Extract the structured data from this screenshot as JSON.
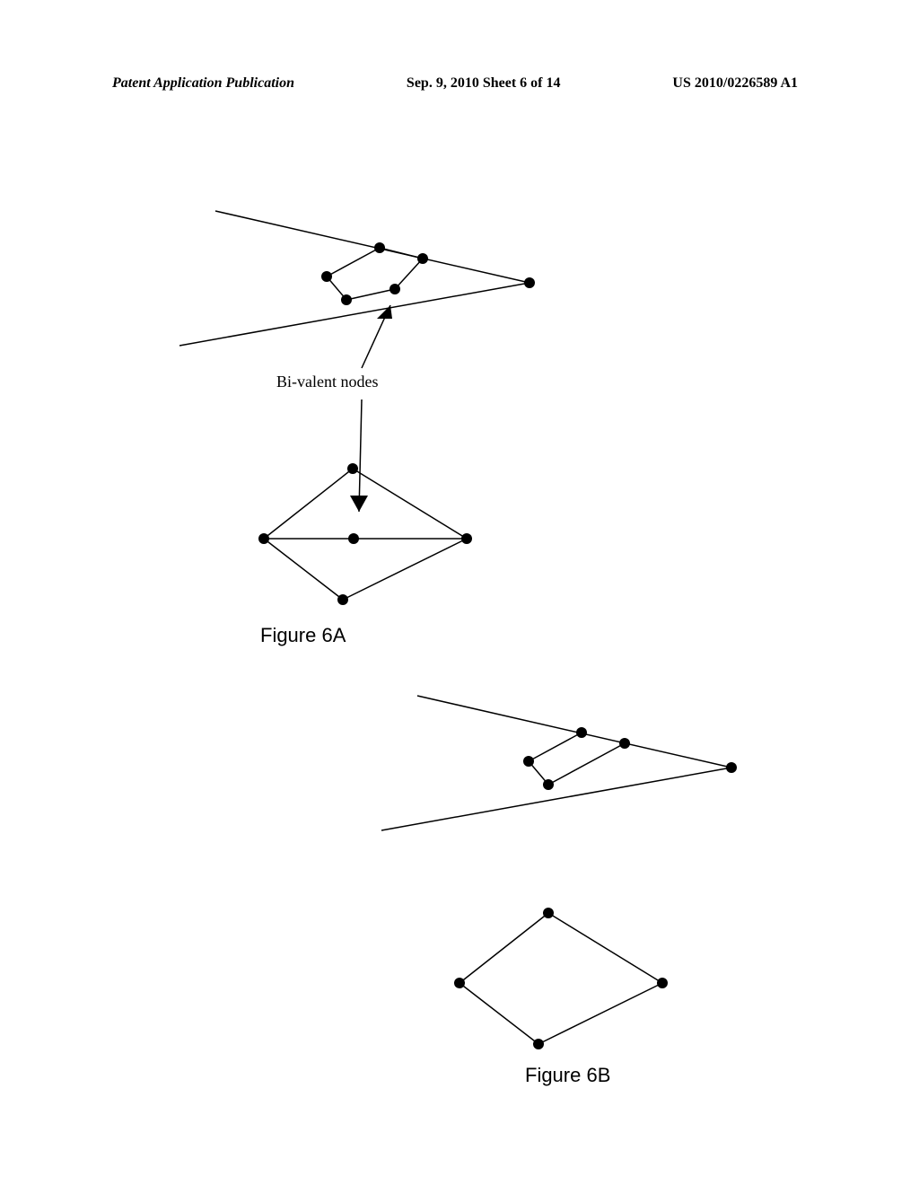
{
  "header": {
    "left": "Patent Application Publication",
    "center": "Sep. 9, 2010  Sheet 6 of 14",
    "right": "US 2010/0226589 A1"
  },
  "labels": {
    "bivalent": "Bi-valent nodes",
    "fig6a": "Figure 6A",
    "fig6b": "Figure 6B"
  },
  "chart_data": {
    "type": "diagram",
    "description": "Patent figure showing graph diagrams with bi-valent nodes before and after processing",
    "figure_6a": {
      "description": "Two graph diagrams with bi-valent nodes indicated by leader lines and arrows",
      "top_graph": {
        "nodes": [
          {
            "id": 1,
            "approx_pos": "upper-center"
          },
          {
            "id": 2,
            "approx_pos": "right"
          },
          {
            "id": 3,
            "approx_pos": "center",
            "bivalent": true
          },
          {
            "id": 4,
            "approx_pos": "center-lower",
            "bivalent": true
          },
          {
            "id": 5,
            "approx_pos": "lower-left"
          }
        ],
        "edges": [
          [
            1,
            2
          ],
          [
            2,
            3
          ],
          [
            3,
            4
          ],
          [
            4,
            1
          ],
          [
            2,
            5
          ]
        ]
      },
      "bottom_graph": {
        "nodes": [
          {
            "id": 1,
            "approx_pos": "top"
          },
          {
            "id": 2,
            "approx_pos": "center",
            "bivalent": true
          },
          {
            "id": 3,
            "approx_pos": "left"
          },
          {
            "id": 4,
            "approx_pos": "right"
          },
          {
            "id": 5,
            "approx_pos": "bottom"
          }
        ],
        "edges": [
          [
            1,
            3
          ],
          [
            1,
            4
          ],
          [
            3,
            2
          ],
          [
            2,
            4
          ],
          [
            3,
            5
          ],
          [
            5,
            4
          ]
        ]
      },
      "annotation": "Bi-valent nodes"
    },
    "figure_6b": {
      "description": "Same two graph diagrams after bi-valent node removal",
      "top_graph": {
        "nodes": [
          {
            "id": 1,
            "approx_pos": "upper-center"
          },
          {
            "id": 2,
            "approx_pos": "right"
          },
          {
            "id": 4,
            "approx_pos": "center-lower"
          },
          {
            "id": 5,
            "approx_pos": "lower-left"
          }
        ],
        "edges": [
          [
            1,
            2
          ],
          [
            2,
            4
          ],
          [
            4,
            1
          ],
          [
            2,
            5
          ]
        ]
      },
      "bottom_graph": {
        "nodes": [
          {
            "id": 1,
            "approx_pos": "top"
          },
          {
            "id": 3,
            "approx_pos": "left"
          },
          {
            "id": 4,
            "approx_pos": "right"
          },
          {
            "id": 5,
            "approx_pos": "bottom"
          }
        ],
        "edges": [
          [
            1,
            3
          ],
          [
            1,
            4
          ],
          [
            3,
            4
          ],
          [
            3,
            5
          ],
          [
            5,
            4
          ]
        ]
      }
    }
  }
}
